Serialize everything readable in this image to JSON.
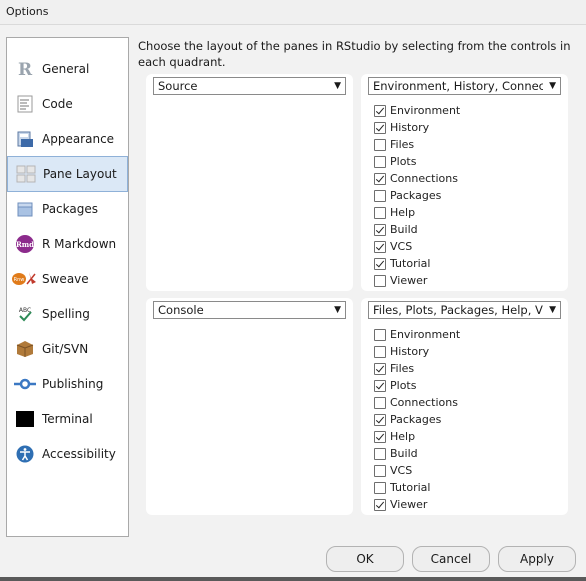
{
  "window": {
    "title": "Options"
  },
  "sidebar": {
    "items": [
      {
        "label": "General",
        "icon": "r-logo-icon"
      },
      {
        "label": "Code",
        "icon": "code-icon"
      },
      {
        "label": "Appearance",
        "icon": "appearance-icon"
      },
      {
        "label": "Pane Layout",
        "icon": "pane-layout-icon",
        "selected": true
      },
      {
        "label": "Packages",
        "icon": "packages-icon"
      },
      {
        "label": "R Markdown",
        "icon": "rmd-icon",
        "badge": "Rmd"
      },
      {
        "label": "Sweave",
        "icon": "sweave-icon",
        "badge": "Rnw"
      },
      {
        "label": "Spelling",
        "icon": "spelling-icon",
        "badge": "ABC"
      },
      {
        "label": "Git/SVN",
        "icon": "git-svn-icon"
      },
      {
        "label": "Publishing",
        "icon": "publishing-icon"
      },
      {
        "label": "Terminal",
        "icon": "terminal-icon"
      },
      {
        "label": "Accessibility",
        "icon": "accessibility-icon"
      }
    ]
  },
  "description": "Choose the layout of the panes in RStudio by selecting from the controls in each quadrant.",
  "quadrants": {
    "top_left": {
      "selected": "Source"
    },
    "top_right": {
      "selected": "Environment, History, Connectio",
      "items": [
        {
          "label": "Environment",
          "checked": true
        },
        {
          "label": "History",
          "checked": true
        },
        {
          "label": "Files",
          "checked": false
        },
        {
          "label": "Plots",
          "checked": false
        },
        {
          "label": "Connections",
          "checked": true
        },
        {
          "label": "Packages",
          "checked": false
        },
        {
          "label": "Help",
          "checked": false
        },
        {
          "label": "Build",
          "checked": true
        },
        {
          "label": "VCS",
          "checked": true
        },
        {
          "label": "Tutorial",
          "checked": true
        },
        {
          "label": "Viewer",
          "checked": false
        }
      ]
    },
    "bottom_left": {
      "selected": "Console"
    },
    "bottom_right": {
      "selected": "Files, Plots, Packages, Help, Vie",
      "items": [
        {
          "label": "Environment",
          "checked": false
        },
        {
          "label": "History",
          "checked": false
        },
        {
          "label": "Files",
          "checked": true
        },
        {
          "label": "Plots",
          "checked": true
        },
        {
          "label": "Connections",
          "checked": false
        },
        {
          "label": "Packages",
          "checked": true
        },
        {
          "label": "Help",
          "checked": true
        },
        {
          "label": "Build",
          "checked": false
        },
        {
          "label": "VCS",
          "checked": false
        },
        {
          "label": "Tutorial",
          "checked": false
        },
        {
          "label": "Viewer",
          "checked": true
        }
      ]
    }
  },
  "buttons": {
    "ok": "OK",
    "cancel": "Cancel",
    "apply": "Apply"
  },
  "colors": {
    "selected_bg": "#dbe8f6",
    "selected_border": "#8fb1d8",
    "panel_bg": "#f2f2f2"
  }
}
